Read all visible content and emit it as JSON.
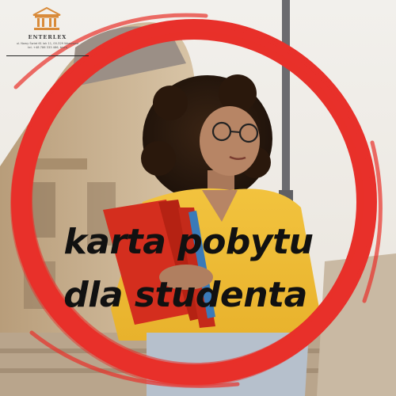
{
  "logo": {
    "icon": "building-columns-icon",
    "name": "ENTERLEX",
    "address_line_1": "ul. Nowy Świat 61 lok 11, 00-329 Warszawa",
    "address_line_2": "tel. +48 786 333 486, biuro"
  },
  "headline": {
    "line1": "karta pobytu",
    "line2": "dla studenta"
  },
  "colors": {
    "ring": "#e8302a",
    "logo_accent": "#d98b3a",
    "text": "#111111"
  }
}
